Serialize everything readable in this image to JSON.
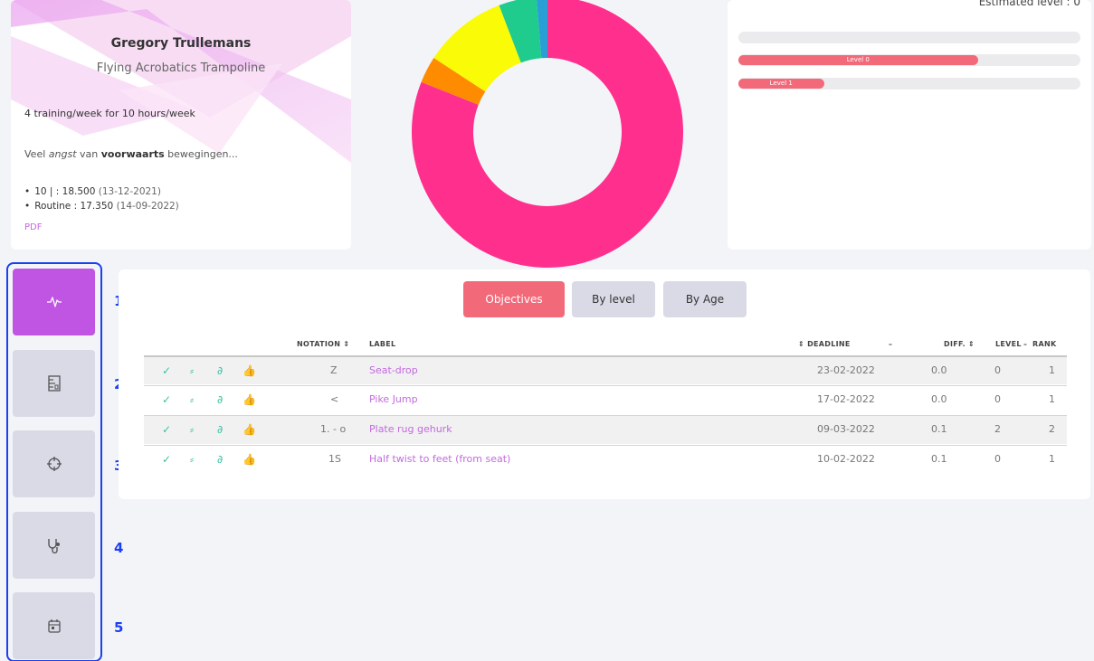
{
  "profile": {
    "name": "Gregory Trullemans",
    "discipline": "Flying Acrobatics Trampoline",
    "training": "4 training/week for 10 hours/week",
    "note": {
      "p1": "Veel ",
      "p2": "angst",
      "p3": " van ",
      "p4": "voorwaarts",
      "p5": " bewegingen..."
    },
    "scores": [
      {
        "label": "10 | : 18.500",
        "date": "(13-12-2021)"
      },
      {
        "label": "Routine : 17.350",
        "date": "(14-09-2022)"
      }
    ],
    "pdf_label": "PDF"
  },
  "donut": {
    "segments": [
      {
        "value": 0.81,
        "color": "#ff2f8e"
      },
      {
        "value": 0.032,
        "color": "#ff8c00"
      },
      {
        "value": 0.1,
        "color": "#fafb06"
      },
      {
        "value": 0.045,
        "color": "#1fcb8d"
      },
      {
        "value": 0.013,
        "color": "#2a9fd6"
      }
    ]
  },
  "levels": {
    "estimated_label": "Estimated level : 0",
    "bars": [
      {
        "label": "",
        "fill": 0
      },
      {
        "label": "Level 0",
        "fill": 0.7
      },
      {
        "label": "Level 1",
        "fill": 0.25
      }
    ]
  },
  "nav": {
    "items": [
      {
        "icon": "activity-icon",
        "number": "1"
      },
      {
        "icon": "ruler-icon",
        "number": "2"
      },
      {
        "icon": "target-icon",
        "number": "3"
      },
      {
        "icon": "stethoscope-icon",
        "number": "4"
      },
      {
        "icon": "calendar-icon",
        "number": "5"
      }
    ]
  },
  "tabs": {
    "objectives": "Objectives",
    "by_level": "By level",
    "by_age": "By Age"
  },
  "table": {
    "headers": {
      "notation": "NOTATION ⇕",
      "label": "LABEL",
      "deadline": "⇕ DEADLINE",
      "deadline_sort": "–",
      "diff": "DIFF. ⇕",
      "level": "LEVEL",
      "level_sort": "–",
      "rank": "RANK"
    },
    "rows": [
      {
        "notation": "Z",
        "label": "Seat-drop",
        "deadline": "23-02-2022",
        "diff": "0.0",
        "level": "0",
        "rank": "1"
      },
      {
        "notation": "<",
        "label": "Pike Jump",
        "deadline": "17-02-2022",
        "diff": "0.0",
        "level": "0",
        "rank": "1"
      },
      {
        "notation": "1. - o",
        "label": "Plate rug gehurk",
        "deadline": "09-03-2022",
        "diff": "0.1",
        "level": "2",
        "rank": "2"
      },
      {
        "notation": "1S",
        "label": "Half twist to feet (from seat)",
        "deadline": "10-02-2022",
        "diff": "0.1",
        "level": "0",
        "rank": "1"
      }
    ],
    "actions": {
      "check": "✓",
      "flags": "⸗",
      "link": "∂",
      "like": "👍"
    }
  },
  "colors": {
    "accent": "#c055e3",
    "primary": "#f26a7a",
    "highlight": "#1b3ff2",
    "success": "#3cc19f"
  }
}
